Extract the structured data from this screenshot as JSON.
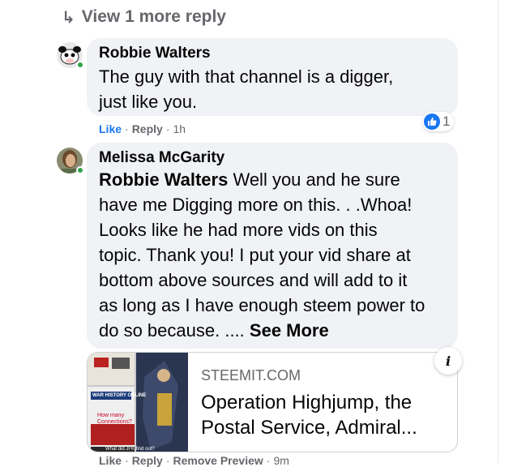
{
  "view_more": {
    "label": "View 1 more reply",
    "icon": "reply-arrow-icon"
  },
  "comments": [
    {
      "author": "Robbie Walters",
      "text_line1": "The guy with that channel is a digger,",
      "text_line2": "just like you.",
      "actions": {
        "like": "Like",
        "reply": "Reply",
        "time": "1h",
        "sep": "·"
      },
      "reactions": {
        "icon": "thumbs-up-icon",
        "count": "1"
      },
      "online": true
    },
    {
      "author": "Melissa McGarity",
      "mention": "Robbie Walters",
      "lines": [
        "Well you and he sure",
        "have me Digging more on this. . .Whoa!",
        "Looks like he had more vids on this",
        "topic. Thank you! I put your vid share at",
        "bottom above sources and will add to it",
        "as long as I have enough steem power to",
        "do so because. ...."
      ],
      "see_more": "See More",
      "online": true,
      "link_preview": {
        "source": "STEEMIT.COM",
        "title_line1": "Operation Highjump, the",
        "title_line2": "Postal Service, Admiral...",
        "info_icon": "i",
        "thumb_texts": [
          "WAR HISTORY ONLINE",
          "How many",
          "Connections?",
          "What did JFK find out?"
        ]
      },
      "actions": {
        "like": "Like",
        "reply": "Reply",
        "remove_preview": "Remove Preview",
        "time": "9m",
        "sep": "·"
      }
    }
  ],
  "colors": {
    "accent": "#1877f2",
    "bubble": "#f0f2f5",
    "muted": "#65676b",
    "online": "#31a24c"
  }
}
